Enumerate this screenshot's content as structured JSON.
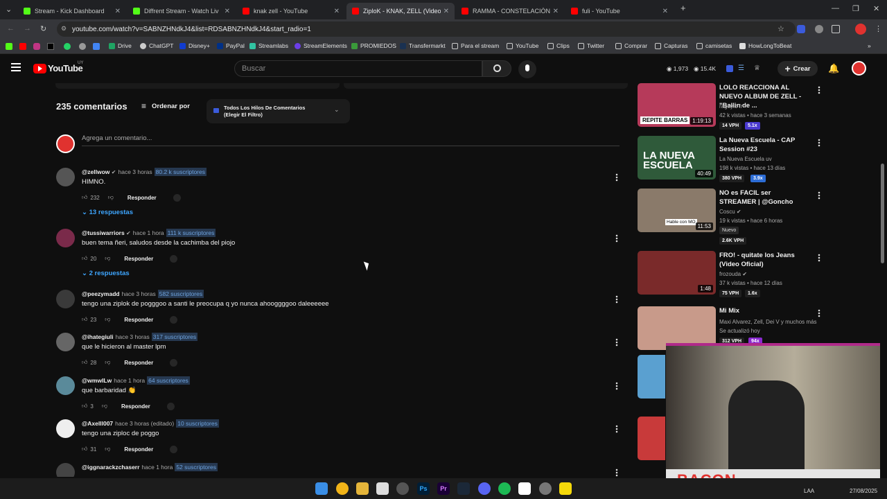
{
  "tabs": [
    {
      "title": "Stream - Kick Dashboard",
      "color": "#53fc18"
    },
    {
      "title": "Diffrent Stream - Watch Liv",
      "color": "#53fc18"
    },
    {
      "title": "knak zell - YouTube",
      "color": "#ff0000"
    },
    {
      "title": "ZiploK - KNAK, ZELL (Video Ofi",
      "color": "#ff0000"
    },
    {
      "title": "RAMMA - CONSTELACIÓN (Vid",
      "color": "#ff0000"
    },
    {
      "title": "fuli - YouTube",
      "color": "#ff0000"
    }
  ],
  "address": {
    "url": "youtube.com/watch?v=SABNZHNdkJ4&list=RDSABNZHNdkJ4&start_radio=1"
  },
  "bookmarks": [
    "Drive",
    "ChatGPT",
    "Disney+",
    "PayPal",
    "Streamlabs",
    "StreamElements",
    "PROMIEDOS",
    "Transfermarkt",
    "Para el stream",
    "YouTube",
    "Clips",
    "Twitter",
    "Comprar",
    "Capturas",
    "camisetas",
    "HowLongToBeat"
  ],
  "youtube": {
    "logo": "YouTube",
    "region": "UY",
    "search_placeholder": "Buscar",
    "viewers": "1,973",
    "followers": "15.4K",
    "create_label": "Crear"
  },
  "comments_header": {
    "count": "235 comentarios",
    "sort": "Ordenar por",
    "filter_line1": "Todos Los Hilos De Comentarios",
    "filter_line2": "(Elegir El Filtro)",
    "add_placeholder": "Agrega un comentario..."
  },
  "comments": [
    {
      "author": "@zellwow",
      "time": "hace 3 horas",
      "subs": "80.2 k suscriptores",
      "text": "HIMNO.",
      "likes": "232",
      "reply": "Responder",
      "replies": "13 respuestas",
      "avatar": "#555"
    },
    {
      "author": "@tussiwarriors",
      "time": "hace 1 hora",
      "subs": "111 k suscriptores",
      "text": "buen tema ñeri, saludos desde la cachimba del piojo",
      "likes": "20",
      "reply": "Responder",
      "replies": "2 respuestas",
      "avatar": "#7a2a4a"
    },
    {
      "author": "@peezymadd",
      "time": "hace 3 horas",
      "subs": "582 suscriptores",
      "text": "tengo una ziplok de pogggoo a santi le preocupa q yo nunca ahooggggoo daleeeeee",
      "likes": "23",
      "reply": "Responder",
      "avatar": "#3a3a3a"
    },
    {
      "author": "@ihategiuli",
      "time": "hace 3 horas",
      "subs": "317 suscriptores",
      "text": "que le hicieron al master lpm",
      "likes": "28",
      "reply": "Responder",
      "avatar": "#666"
    },
    {
      "author": "@wmwlLw",
      "time": "hace 1 hora",
      "subs": "64 suscriptores",
      "text": "que barbaridad 👏",
      "likes": "3",
      "reply": "Responder",
      "avatar": "#5a8a9a"
    },
    {
      "author": "@Axelll007",
      "time": "hace 3 horas (editado)",
      "subs": "10 suscriptores",
      "text": "tengo una ziploc de poggo",
      "likes": "31",
      "reply": "Responder",
      "avatar": "#eeeeee"
    },
    {
      "author": "@iggnarackzchaserr",
      "time": "hace 1 hora",
      "subs": "52 suscriptores",
      "text": "",
      "likes": "",
      "reply": "",
      "avatar": "#444"
    }
  ],
  "videos": [
    {
      "title": "LOLO REACCIONA AL NUEVO ALBUM DE ZELL - \"Ballin de ...",
      "channel": "rageylo fr",
      "meta": "42 k vistas • hace 3 semanas",
      "duration": "1:19:13",
      "vph": "14 VPH",
      "ratio": "5.1x",
      "thumb": "#b63a5a"
    },
    {
      "title": "La Nueva Escuela - CAP Session #23",
      "channel": "La Nueva Escuela uv",
      "meta": "198 k vistas • hace 13 días",
      "duration": "40:49",
      "vph": "380 VPH",
      "ratio": "3.9x",
      "thumb": "#2f5a3a"
    },
    {
      "title": "NO es FACIL ser STREAMER | @Goncho",
      "channel": "Coscu",
      "meta": "19 k vistas • hace 6 horas",
      "duration": "11:53",
      "badge": "Nuevo",
      "vph": "2.6K VPH",
      "thumb": "#8a7a6a"
    },
    {
      "title": "FRO! - quitate los Jeans (Video Oficial)",
      "channel": "frozouda",
      "meta": "37 k vistas • hace 12 días",
      "duration": "1:48",
      "vph": "75 VPH",
      "ratio": "1.6x",
      "thumb": "#7a2a2a"
    },
    {
      "title": "Mi Mix",
      "channel": "Maxi Alvarez, Zell, Dei V y muchos más",
      "meta": "Se actualizó hoy",
      "vph": "312 VPH",
      "ratio": "94x",
      "thumb": "#c89a8a"
    }
  ],
  "overlay": {
    "text": "BACON"
  },
  "taskbar": {
    "lang": "LAA",
    "date": "27/08/2025"
  }
}
